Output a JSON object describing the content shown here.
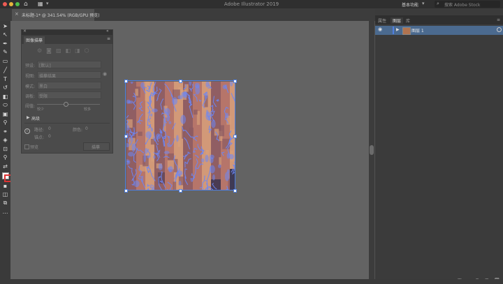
{
  "window": {
    "app_title": "Adobe Illustrator 2019",
    "workspace": "基本功能",
    "stock_search_placeholder": "搜索 Adobe Stock"
  },
  "document_tab": {
    "label": "未标题-1* @ 341.54% (RGB/GPU 预览)",
    "close_glyph": "×"
  },
  "trace_panel": {
    "title": "图像描摹",
    "preset_label": "预设:",
    "preset_value": "[默认]",
    "view_label": "视图:",
    "view_value": "描摹结果",
    "mode_label": "模式:",
    "mode_value": "黑白",
    "palette_label": "调板:",
    "palette_value": "受限",
    "threshold_label": "阈值:",
    "threshold_min": "较少",
    "threshold_max": "较多",
    "threshold_value": 0.45,
    "advanced_label": "高级",
    "paths_label": "路径:",
    "paths_value": "0",
    "colors_label": "颜色:",
    "colors_value": "0",
    "anchors_label": "锚点:",
    "anchors_value": "0",
    "preview_label": "预览",
    "trace_button": "描摹"
  },
  "layers_panel": {
    "tabs": [
      "属性",
      "图层",
      "库"
    ],
    "layer_name": "图层 1",
    "eye_glyph": "◉",
    "thumbnail_color": "#b0734f"
  },
  "colors": {
    "trace_outline": "#6b86f5",
    "wood_base": "#b6756a",
    "wood_dark": "#8a5a62",
    "wood_light": "#d7a07a",
    "selection": "#4f7fe0"
  }
}
